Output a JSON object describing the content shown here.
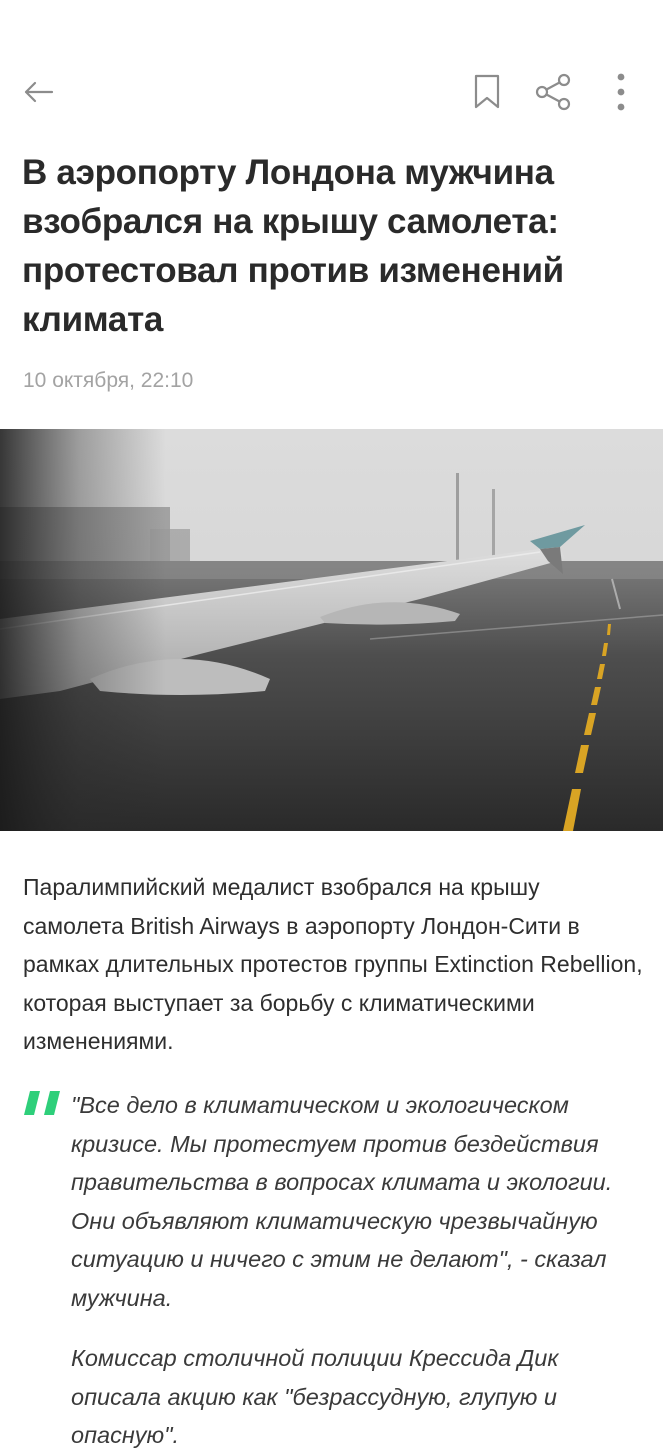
{
  "header": {
    "back_icon": "arrow-left-icon",
    "bookmark_icon": "bookmark-icon",
    "share_icon": "share-icon",
    "more_icon": "more-vertical-icon"
  },
  "article": {
    "title": "В аэропорту Лондона мужчина взобрался на крышу самолета: протестовал против изменений климата",
    "date": "10 октября, 22:10",
    "lead": "Паралимпийский медалист взобрался на крышу самолета British Airways в аэропорту Лондон-Сити в рамках длительных протестов группы Extinction Rebellion, которая выступает за борьбу с климатическими изменениями.",
    "quote": "\"Все дело в климатическом и экологическом кризисе. Мы протестуем против бездействия правительства в вопросах климата и экологии. Они объявляют климатическую чрезвычайную ситуацию и ничего с этим не делают\", - сказал мужчина.",
    "quote_continued": "Комиссар столичной полиции Крессида Дик описала акцию как \"безрассудную, глупую и опасную\"."
  },
  "colors": {
    "quote_accent": "#2ecf7a",
    "date_gray": "#a3a3a3",
    "icon_gray": "#8c8c8c"
  }
}
